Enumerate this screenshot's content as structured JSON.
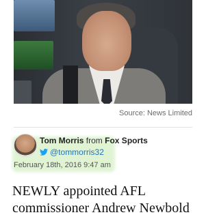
{
  "image": {
    "caption": "Source: News Limited"
  },
  "author": {
    "name": "Tom Morris",
    "from_word": "from",
    "publication": "Fox Sports",
    "twitter_handle": "@tommorris32",
    "date": "February 18th, 2016 9:47 am",
    "icons": [
      "avatar",
      "twitter-bird-icon"
    ]
  },
  "article": {
    "lines": [
      "NEWLY appointed AFL",
      "commissioner Andrew Newbold"
    ]
  },
  "colors": {
    "link": "#1e73b8",
    "highlight": "#d5f0c5",
    "caption": "#6b6b6b"
  }
}
